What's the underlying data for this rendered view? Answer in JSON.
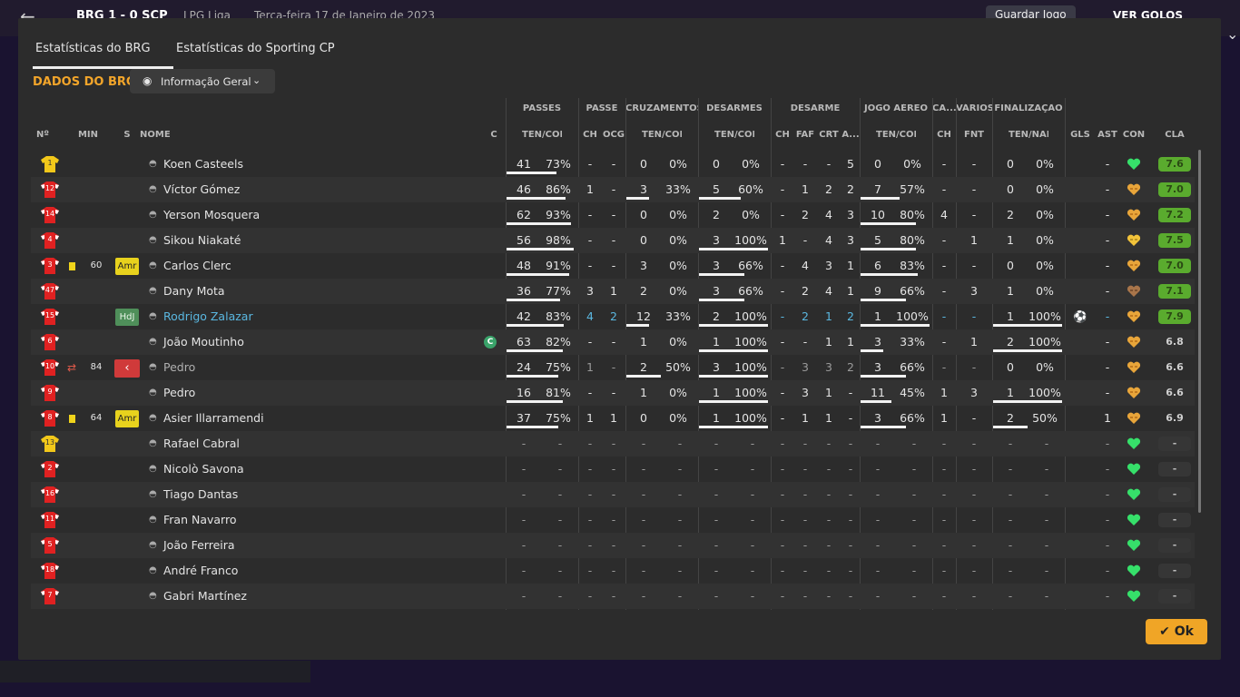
{
  "background": {
    "back_icon": "←",
    "score": "BRG 1 - 0 SCP",
    "league": "LPG Liga",
    "date": "Terça-feira 17 de Janeiro de 2023",
    "save_label": "Guardar Jogo",
    "goals_label": "VER GOLOS"
  },
  "tabs": [
    {
      "label": "Estatísticas do BRG",
      "active": true
    },
    {
      "label": "Estatísticas do Sporting CP",
      "active": false
    }
  ],
  "section_title": "DADOS DO BRG",
  "view_dropdown": {
    "label": "Informação Geral"
  },
  "group_headers": [
    {
      "key": "passes",
      "label": "PASSES"
    },
    {
      "key": "passe",
      "label": "PASSE"
    },
    {
      "key": "cruz",
      "label": "CRUZAMENTOS"
    },
    {
      "key": "desarmes",
      "label": "DESARMES"
    },
    {
      "key": "desarme",
      "label": "DESARME"
    },
    {
      "key": "aereo",
      "label": "JOGO AÉREO"
    },
    {
      "key": "ca",
      "label": "CA..."
    },
    {
      "key": "varios",
      "label": "VÁRIOS"
    },
    {
      "key": "final",
      "label": "FINALIZAÇÃO"
    }
  ],
  "col_headers": {
    "num": "Nº",
    "min": "MIN",
    "s": "S",
    "name": "NOME",
    "c": "C",
    "passes": "TEN/CON",
    "passe_ch": "CH",
    "passe_ocg": "OCG",
    "cruz": "TEN/CON",
    "desarmes": "TEN/CON",
    "des_ch": "CH",
    "des_faf": "FAF",
    "des_crt": "CRT",
    "des_a": "A...",
    "aereo": "TEN/CON",
    "ca_ch": "CH",
    "fnt": "FNT",
    "final": "TEN/NAL",
    "gls": "GLS",
    "ast": "AST",
    "con": "CON",
    "cla": "CLA"
  },
  "players": [
    {
      "num": "1",
      "gk": true,
      "min": "",
      "card": false,
      "sub": "",
      "s": "",
      "name": "Koen Casteels",
      "state": "normal",
      "captain": false,
      "p": [
        "41",
        "73%"
      ],
      "pf": 0.73,
      "pch": "-",
      "pocg": "-",
      "cr": [
        "0",
        "0%"
      ],
      "crf": 0,
      "de": [
        "0",
        "0%"
      ],
      "def": 0,
      "dch": "-",
      "dfaf": "-",
      "dcrt": "-",
      "da": "5",
      "ae": [
        "0",
        "0%"
      ],
      "aef": 0,
      "cach": "-",
      "fnt": "-",
      "fi": [
        "0",
        "0%"
      ],
      "fif": 0,
      "gls": "",
      "ast": "-",
      "con": "great",
      "cla": "7.6",
      "cla_type": "good"
    },
    {
      "num": "12",
      "gk": false,
      "min": "",
      "card": false,
      "sub": "",
      "s": "",
      "name": "Víctor Gómez",
      "state": "normal",
      "captain": false,
      "p": [
        "46",
        "86%"
      ],
      "pf": 0.86,
      "pch": "1",
      "pocg": "-",
      "cr": [
        "3",
        "33%"
      ],
      "crf": 0.33,
      "de": [
        "5",
        "60%"
      ],
      "def": 0.6,
      "dch": "-",
      "dfaf": "1",
      "dcrt": "2",
      "da": "2",
      "ae": [
        "7",
        "57%"
      ],
      "aef": 0.57,
      "cach": "-",
      "fnt": "-",
      "fi": [
        "0",
        "0%"
      ],
      "fif": 0,
      "gls": "",
      "ast": "-",
      "con": "ok",
      "cla": "7.0",
      "cla_type": "good"
    },
    {
      "num": "14",
      "gk": false,
      "min": "",
      "card": false,
      "sub": "",
      "s": "",
      "name": "Yerson Mosquera",
      "state": "normal",
      "captain": false,
      "p": [
        "62",
        "93%"
      ],
      "pf": 0.93,
      "pch": "-",
      "pocg": "-",
      "cr": [
        "0",
        "0%"
      ],
      "crf": 0,
      "de": [
        "2",
        "0%"
      ],
      "def": 0,
      "dch": "-",
      "dfaf": "2",
      "dcrt": "4",
      "da": "3",
      "ae": [
        "10",
        "80%"
      ],
      "aef": 0.8,
      "cach": "4",
      "fnt": "-",
      "fi": [
        "2",
        "0%"
      ],
      "fif": 0,
      "gls": "",
      "ast": "-",
      "con": "ok",
      "cla": "7.2",
      "cla_type": "good"
    },
    {
      "num": "4",
      "gk": false,
      "min": "",
      "card": false,
      "sub": "",
      "s": "",
      "name": "Sikou Niakaté",
      "state": "normal",
      "captain": false,
      "p": [
        "56",
        "98%"
      ],
      "pf": 0.98,
      "pch": "-",
      "pocg": "-",
      "cr": [
        "0",
        "0%"
      ],
      "crf": 0,
      "de": [
        "3",
        "100%"
      ],
      "def": 1,
      "dch": "1",
      "dfaf": "-",
      "dcrt": "4",
      "da": "3",
      "ae": [
        "5",
        "80%"
      ],
      "aef": 0.8,
      "cach": "-",
      "fnt": "1",
      "fi": [
        "1",
        "0%"
      ],
      "fif": 0,
      "gls": "",
      "ast": "-",
      "con": "good",
      "cla": "7.5",
      "cla_type": "good"
    },
    {
      "num": "3",
      "gk": false,
      "min": "60",
      "card": true,
      "sub": "",
      "s": "Amr",
      "name": "Carlos Clerc",
      "state": "normal",
      "captain": false,
      "p": [
        "48",
        "91%"
      ],
      "pf": 0.91,
      "pch": "-",
      "pocg": "-",
      "cr": [
        "3",
        "0%"
      ],
      "crf": 0,
      "de": [
        "3",
        "66%"
      ],
      "def": 0.66,
      "dch": "-",
      "dfaf": "4",
      "dcrt": "3",
      "da": "1",
      "ae": [
        "6",
        "83%"
      ],
      "aef": 0.83,
      "cach": "-",
      "fnt": "-",
      "fi": [
        "0",
        "0%"
      ],
      "fif": 0,
      "gls": "",
      "ast": "-",
      "con": "ok",
      "cla": "7.0",
      "cla_type": "good"
    },
    {
      "num": "47",
      "gk": false,
      "min": "",
      "card": false,
      "sub": "",
      "s": "",
      "name": "Dany Mota",
      "state": "normal",
      "captain": false,
      "p": [
        "36",
        "77%"
      ],
      "pf": 0.77,
      "pch": "3",
      "pocg": "1",
      "cr": [
        "2",
        "0%"
      ],
      "crf": 0,
      "de": [
        "3",
        "66%"
      ],
      "def": 0.66,
      "dch": "-",
      "dfaf": "2",
      "dcrt": "4",
      "da": "1",
      "ae": [
        "9",
        "66%"
      ],
      "aef": 0.66,
      "cach": "-",
      "fnt": "3",
      "fi": [
        "1",
        "0%"
      ],
      "fif": 0,
      "gls": "",
      "ast": "-",
      "con": "low",
      "cla": "7.1",
      "cla_type": "good"
    },
    {
      "num": "15",
      "gk": false,
      "min": "",
      "card": false,
      "sub": "",
      "s": "HdJ",
      "name": "Rodrigo Zalazar",
      "state": "selected",
      "captain": false,
      "p": [
        "42",
        "83%"
      ],
      "pf": 0.83,
      "pch": "4",
      "pocg": "2",
      "cr": [
        "12",
        "33%"
      ],
      "crf": 0.33,
      "de": [
        "2",
        "100%"
      ],
      "def": 1,
      "dch": "-",
      "dfaf": "2",
      "dcrt": "1",
      "da": "2",
      "ae": [
        "1",
        "100%"
      ],
      "aef": 1,
      "cach": "-",
      "fnt": "-",
      "fi": [
        "1",
        "100%"
      ],
      "fif": 1,
      "gls": "⚽",
      "ast": "-",
      "con": "ok",
      "cla": "7.9",
      "cla_type": "good"
    },
    {
      "num": "6",
      "gk": false,
      "min": "",
      "card": false,
      "sub": "",
      "s": "",
      "name": "João Moutinho",
      "state": "normal",
      "captain": true,
      "p": [
        "63",
        "82%"
      ],
      "pf": 0.82,
      "pch": "-",
      "pocg": "-",
      "cr": [
        "1",
        "0%"
      ],
      "crf": 0,
      "de": [
        "1",
        "100%"
      ],
      "def": 1,
      "dch": "-",
      "dfaf": "-",
      "dcrt": "1",
      "da": "1",
      "ae": [
        "3",
        "33%"
      ],
      "aef": 0.33,
      "cach": "-",
      "fnt": "1",
      "fi": [
        "2",
        "100%"
      ],
      "fif": 1,
      "gls": "",
      "ast": "-",
      "con": "ok",
      "cla": "6.8",
      "cla_type": "mid"
    },
    {
      "num": "10",
      "gk": false,
      "min": "84",
      "card": false,
      "sub": "out",
      "s": "",
      "name": "Pedro",
      "state": "sub",
      "captain": false,
      "p": [
        "24",
        "75%"
      ],
      "pf": 0.75,
      "pch": "1",
      "pocg": "-",
      "cr": [
        "2",
        "50%"
      ],
      "crf": 0.5,
      "de": [
        "3",
        "100%"
      ],
      "def": 1,
      "dch": "-",
      "dfaf": "3",
      "dcrt": "3",
      "da": "2",
      "ae": [
        "3",
        "66%"
      ],
      "aef": 0.66,
      "cach": "-",
      "fnt": "-",
      "fi": [
        "0",
        "0%"
      ],
      "fif": 0,
      "gls": "",
      "ast": "-",
      "con": "ok",
      "cla": "6.6",
      "cla_type": "mid"
    },
    {
      "num": "9",
      "gk": false,
      "min": "",
      "card": false,
      "sub": "",
      "s": "",
      "name": "Pedro",
      "state": "normal",
      "captain": false,
      "p": [
        "16",
        "81%"
      ],
      "pf": 0.81,
      "pch": "-",
      "pocg": "-",
      "cr": [
        "1",
        "0%"
      ],
      "crf": 0,
      "de": [
        "1",
        "100%"
      ],
      "def": 1,
      "dch": "-",
      "dfaf": "3",
      "dcrt": "1",
      "da": "-",
      "ae": [
        "11",
        "45%"
      ],
      "aef": 0.45,
      "cach": "1",
      "fnt": "3",
      "fi": [
        "1",
        "100%"
      ],
      "fif": 1,
      "gls": "",
      "ast": "-",
      "con": "ok",
      "cla": "6.6",
      "cla_type": "mid"
    },
    {
      "num": "8",
      "gk": false,
      "min": "64",
      "card": true,
      "sub": "",
      "s": "Amr",
      "name": "Asier Illarramendi",
      "state": "normal",
      "captain": false,
      "p": [
        "37",
        "75%"
      ],
      "pf": 0.75,
      "pch": "1",
      "pocg": "1",
      "cr": [
        "0",
        "0%"
      ],
      "crf": 0,
      "de": [
        "1",
        "100%"
      ],
      "def": 1,
      "dch": "-",
      "dfaf": "1",
      "dcrt": "1",
      "da": "-",
      "ae": [
        "3",
        "66%"
      ],
      "aef": 0.66,
      "cach": "1",
      "fnt": "-",
      "fi": [
        "2",
        "50%"
      ],
      "fif": 0.5,
      "gls": "",
      "ast": "1",
      "con": "ok",
      "cla": "6.9",
      "cla_type": "mid"
    },
    {
      "num": "13",
      "gk": true,
      "bench": true,
      "name": "Rafael Cabral"
    },
    {
      "num": "2",
      "gk": false,
      "bench": true,
      "name": "Nicolò Savona"
    },
    {
      "num": "16",
      "gk": false,
      "bench": true,
      "name": "Tiago Dantas"
    },
    {
      "num": "11",
      "gk": false,
      "bench": true,
      "name": "Fran Navarro"
    },
    {
      "num": "5",
      "gk": false,
      "bench": true,
      "name": "João Ferreira"
    },
    {
      "num": "18",
      "gk": false,
      "bench": true,
      "name": "André Franco"
    },
    {
      "num": "7",
      "gk": false,
      "bench": true,
      "name": "Gabri Martínez"
    }
  ],
  "bench_dash": "-",
  "ok_label": "Ok",
  "ok_icon": "✔",
  "colors": {
    "accent": "#f0a526",
    "rating_good": "#5aab2e",
    "selected_name": "#5ab7e0",
    "condition_great": "#36e06a",
    "condition_ok": "#e8a53a"
  }
}
